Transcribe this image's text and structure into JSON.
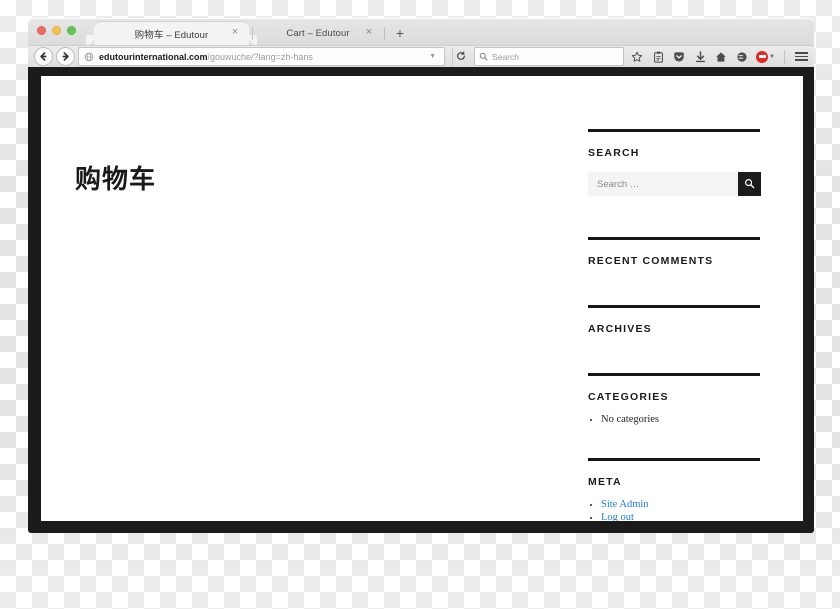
{
  "browser": {
    "window_controls": [
      "close",
      "minimize",
      "zoom"
    ],
    "tabs": [
      {
        "title": "购物车 – Edutour",
        "active": true,
        "close_label": "×"
      },
      {
        "title": "Cart – Edutour",
        "active": false,
        "close_label": "×"
      }
    ],
    "new_tab_label": "+",
    "url": {
      "host": "edutourinternational.com",
      "path": "/gouwuche/?lang=zh-hans"
    },
    "browser_search_placeholder": "Search",
    "toolbar_icons": [
      "bookmark-star-icon",
      "reading-list-icon",
      "pocket-icon",
      "downloads-icon",
      "home-icon",
      "sync-chat-icon",
      "adblock-plus-icon",
      "menu-hamburger-icon"
    ]
  },
  "page": {
    "title": "购物车",
    "sidebar": {
      "widgets": [
        {
          "id": "search",
          "title": "SEARCH",
          "search_placeholder": "Search …",
          "search_value": "",
          "submit_icon": "search-icon"
        },
        {
          "id": "recent-comments",
          "title": "RECENT COMMENTS",
          "items": []
        },
        {
          "id": "archives",
          "title": "ARCHIVES",
          "items": []
        },
        {
          "id": "categories",
          "title": "CATEGORIES",
          "items": [
            {
              "label": "No categories",
              "link": false
            }
          ]
        },
        {
          "id": "meta",
          "title": "META",
          "items": [
            {
              "label": "Site Admin",
              "link": true
            },
            {
              "label": "Log out",
              "link": true
            }
          ]
        }
      ]
    }
  },
  "colors": {
    "accent_link": "#1b7fd4",
    "rule": "#161616",
    "search_button": "#1c1c1c",
    "frame": "#1b1b1b",
    "adblock_red": "#e02a26"
  }
}
